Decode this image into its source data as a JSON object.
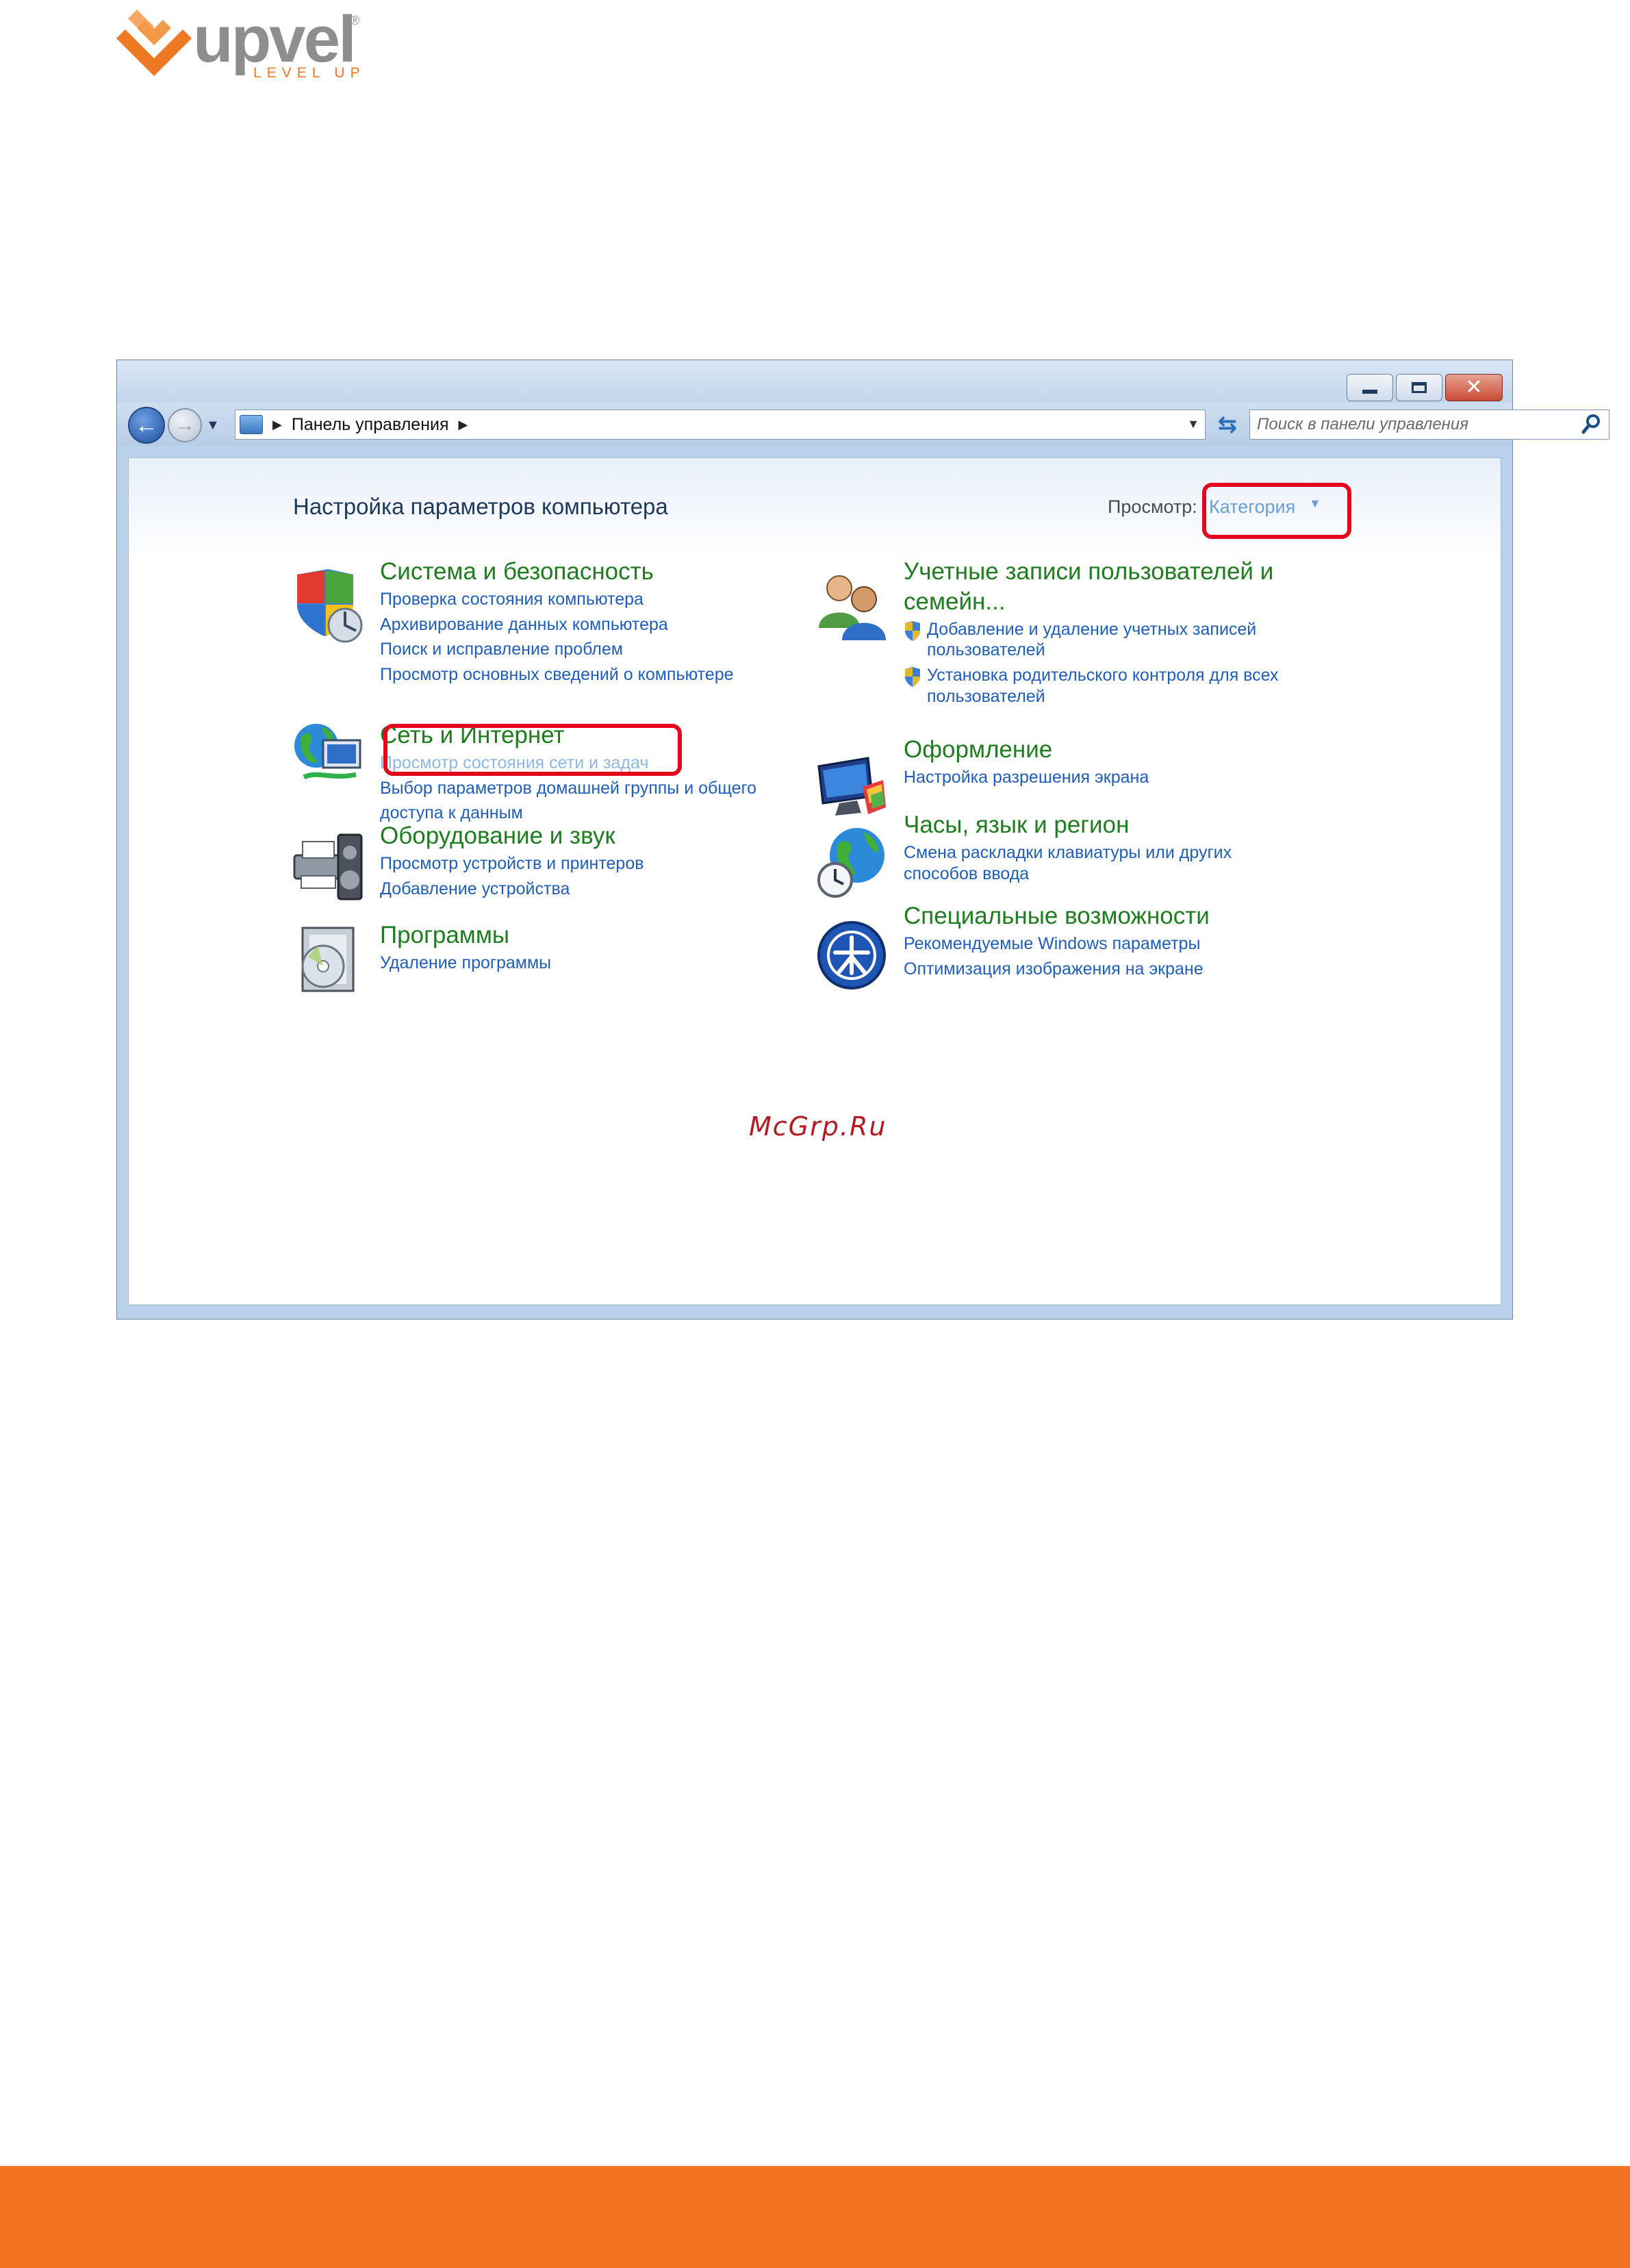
{
  "brand": {
    "name": "upvel",
    "tagline": "LEVEL UP",
    "registered": "®"
  },
  "window": {
    "address": {
      "path": "Панель управления"
    },
    "search": {
      "placeholder": "Поиск в панели управления"
    }
  },
  "content": {
    "title": "Настройка параметров компьютера",
    "view_label": "Просмотр:",
    "view_value": "Категория",
    "categories_left": [
      {
        "title": "Система и безопасность",
        "links": [
          "Проверка состояния компьютера",
          "Архивирование данных компьютера",
          "Поиск и исправление проблем",
          "Просмотр основных сведений о компьютере"
        ]
      },
      {
        "title": "Сеть и Интернет",
        "links": [
          "Просмотр состояния сети и задач",
          "Выбор параметров домашней группы и общего",
          "доступа к данным"
        ]
      },
      {
        "title": "Оборудование и звук",
        "links": [
          "Просмотр устройств и принтеров",
          "Добавление устройства"
        ]
      },
      {
        "title": "Программы",
        "links": [
          "Удаление программы"
        ]
      }
    ],
    "categories_right": [
      {
        "title_line1": "Учетные записи пользователей и",
        "title_line2": "семейн...",
        "links": [
          {
            "line1": "Добавление и удаление учетных записей",
            "line2": "пользователей"
          },
          {
            "line1": "Установка родительского контроля для всех",
            "line2": "пользователей"
          }
        ]
      },
      {
        "title": "Оформление",
        "links": [
          "Настройка разрешения экрана"
        ]
      },
      {
        "title": "Часы, язык и регион",
        "links": [
          "Смена раскладки клавиатуры или других",
          "способов ввода"
        ]
      },
      {
        "title": "Специальные возможности",
        "links": [
          "Рекомендуемые Windows параметры",
          "Оптимизация изображения на экране"
        ]
      }
    ]
  },
  "watermark": "McGrp.Ru",
  "colors": {
    "brand_orange": "#f27321",
    "highlight_red": "#e3061d",
    "category_green": "#1e7d1e",
    "link_blue": "#1f5eba"
  }
}
